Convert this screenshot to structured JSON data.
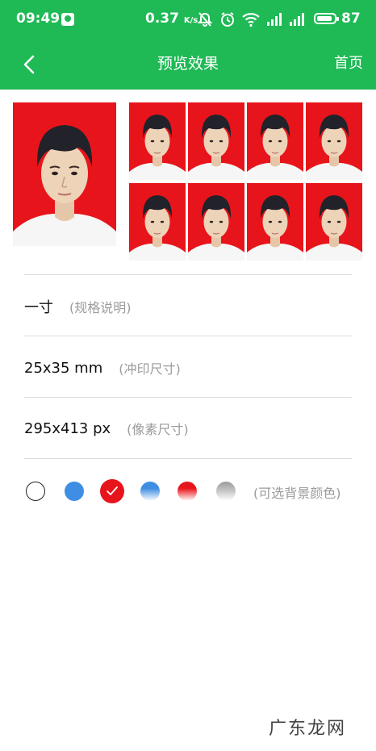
{
  "status_bar": {
    "time": "09:49",
    "network_speed": "0.37",
    "network_unit": "K/s",
    "battery_percent": "87",
    "icons": [
      "app-notification-icon",
      "mute-icon",
      "alarm-icon",
      "wifi-icon",
      "signal-4g-icon",
      "signal-4g-icon",
      "battery-icon"
    ]
  },
  "nav": {
    "back_icon": "back-arrow-icon",
    "title": "预览效果",
    "home_label": "首页"
  },
  "preview": {
    "large_photo": "id-photo-large",
    "thumbnails": [
      "id-photo-thumb",
      "id-photo-thumb",
      "id-photo-thumb",
      "id-photo-thumb",
      "id-photo-thumb",
      "id-photo-thumb",
      "id-photo-thumb",
      "id-photo-thumb"
    ],
    "background_color": "#e8141b"
  },
  "specs": [
    {
      "value": "一寸",
      "note": "(规格说明)"
    },
    {
      "value": "25x35 mm",
      "note": "(冲印尺寸)"
    },
    {
      "value": "295x413 px",
      "note": "(像素尺寸)"
    }
  ],
  "background_options": {
    "colors": [
      {
        "name": "white",
        "hex": "#ffffff"
      },
      {
        "name": "blue",
        "hex": "#3e8ee3"
      },
      {
        "name": "red",
        "hex": "#e8141b",
        "selected": true
      },
      {
        "name": "blue-gradient",
        "hex": "#3e8ee3"
      },
      {
        "name": "red-gradient",
        "hex": "#e8141b"
      },
      {
        "name": "gray-gradient",
        "hex": "#9a9a9a"
      }
    ],
    "note": "(可选背景颜色)"
  },
  "watermark": "广东龙网",
  "colors": {
    "accent": "#1fb955",
    "divider": "#dcdcdc",
    "muted_text": "#9b9b9b"
  }
}
